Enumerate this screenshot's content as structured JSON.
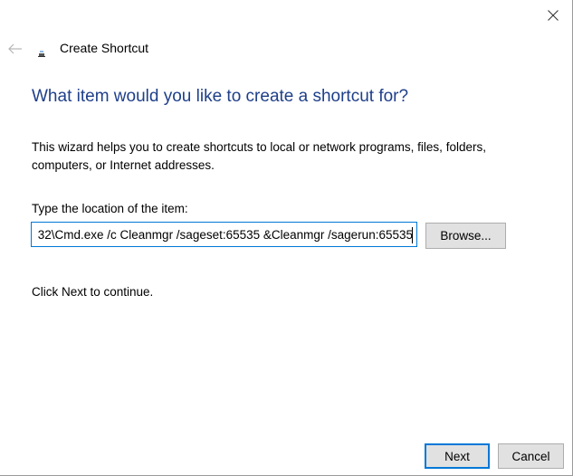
{
  "window": {
    "title": "Create Shortcut"
  },
  "page": {
    "heading": "What item would you like to create a shortcut for?",
    "description": "This wizard helps you to create shortcuts to local or network programs, files, folders, computers, or Internet addresses.",
    "location_label": "Type the location of the item:",
    "location_value": "32\\Cmd.exe /c Cleanmgr /sageset:65535 &Cleanmgr /sagerun:65535",
    "continue_text": "Click Next to continue."
  },
  "buttons": {
    "browse": "Browse...",
    "next": "Next",
    "cancel": "Cancel"
  },
  "icons": {
    "close": "close-icon",
    "back": "back-arrow-icon",
    "title": "shortcut-wizard-icon"
  },
  "colors": {
    "heading": "#1e3f8a",
    "focus_border": "#0078d7",
    "button_bg": "#e1e1e1"
  }
}
